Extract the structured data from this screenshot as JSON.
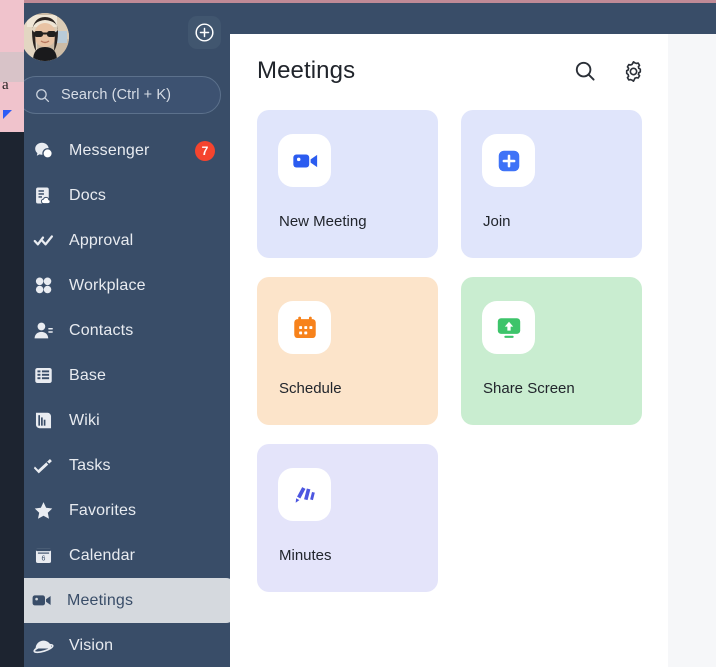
{
  "background": {
    "letter": "a"
  },
  "colors": {
    "sidebar_bg": "#394d68",
    "panel_bg": "#ffffff",
    "accent_blue": "#2b5cf0",
    "accent_orange": "#f7821b",
    "accent_green": "#3dc46a",
    "accent_purple": "#4c56e0",
    "badge_red": "#f5442e",
    "top_accent": "#c08a96",
    "active_item_bg": "#d5d9de"
  },
  "sidebar": {
    "avatar": {
      "name": "user-avatar"
    },
    "add_button": {
      "icon": "plus-circle-icon",
      "label": ""
    },
    "search": {
      "icon": "search-icon",
      "label": "Search (Ctrl + K)"
    },
    "items": [
      {
        "label": "Messenger",
        "icon": "messenger-icon",
        "badge": "7",
        "active": false
      },
      {
        "label": "Docs",
        "icon": "docs-icon",
        "badge": "",
        "active": false
      },
      {
        "label": "Approval",
        "icon": "approval-icon",
        "badge": "",
        "active": false
      },
      {
        "label": "Workplace",
        "icon": "workplace-icon",
        "badge": "",
        "active": false
      },
      {
        "label": "Contacts",
        "icon": "contacts-icon",
        "badge": "",
        "active": false
      },
      {
        "label": "Base",
        "icon": "base-icon",
        "badge": "",
        "active": false
      },
      {
        "label": "Wiki",
        "icon": "wiki-icon",
        "badge": "",
        "active": false
      },
      {
        "label": "Tasks",
        "icon": "tasks-icon",
        "badge": "",
        "active": false
      },
      {
        "label": "Favorites",
        "icon": "favorites-star-icon",
        "badge": "",
        "active": false
      },
      {
        "label": "Calendar",
        "icon": "calendar-icon",
        "badge": "",
        "active": false
      },
      {
        "label": "Meetings",
        "icon": "meetings-video-icon",
        "badge": "",
        "active": true
      },
      {
        "label": "Vision",
        "icon": "vision-icon",
        "badge": "",
        "active": false
      }
    ]
  },
  "panel": {
    "title": "Meetings",
    "actions": [
      {
        "name": "search-icon",
        "label": "Search"
      },
      {
        "name": "gear-icon",
        "label": "Settings"
      }
    ],
    "cards": [
      {
        "label": "New Meeting",
        "icon": "video-camera-icon",
        "bg": "#e0e5fb",
        "icon_color": "#2b5cf0"
      },
      {
        "label": "Join",
        "icon": "plus-square-icon",
        "bg": "#e0e5fb",
        "icon_color": "#2b5cf0"
      },
      {
        "label": "Schedule",
        "icon": "calendar-dots-icon",
        "bg": "#fce4ca",
        "icon_color": "#f7821b"
      },
      {
        "label": "Share Screen",
        "icon": "screen-share-icon",
        "bg": "#c9edd0",
        "icon_color": "#3dc46a"
      },
      {
        "label": "Minutes",
        "icon": "minutes-marker-icon",
        "bg": "#e4e4fa",
        "icon_color": "#4c56e0"
      }
    ]
  }
}
